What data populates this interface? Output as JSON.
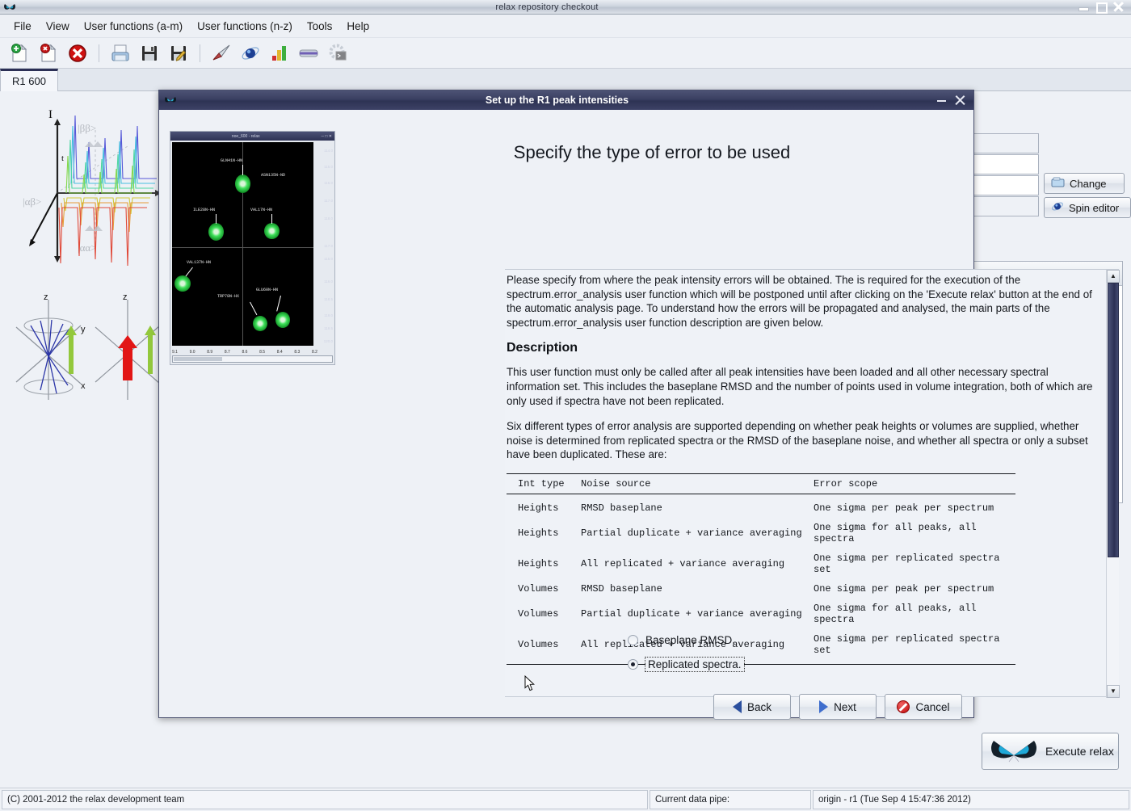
{
  "window": {
    "title": "relax repository checkout",
    "icon": "butterfly-icon",
    "minimize": "–",
    "maximize": "□",
    "close": "✕"
  },
  "menubar": {
    "items": [
      {
        "label": "File"
      },
      {
        "label": "View"
      },
      {
        "label": "User functions (a-m)"
      },
      {
        "label": "User functions (n-z)"
      },
      {
        "label": "Tools"
      },
      {
        "label": "Help"
      }
    ]
  },
  "toolbar": {
    "items": [
      {
        "name": "new-analysis-icon",
        "title": "New analysis"
      },
      {
        "name": "close-analysis-icon",
        "title": "Close analysis"
      },
      {
        "name": "close-all-analyses-icon",
        "title": "Close all analyses"
      },
      {
        "name": "open-state-icon",
        "title": "Open relax state"
      },
      {
        "name": "save-state-icon",
        "title": "Save state"
      },
      {
        "name": "save-state-as-icon",
        "title": "Save state as"
      },
      {
        "name": "run-script-icon",
        "title": "Run script"
      },
      {
        "name": "spin-viewer-icon",
        "title": "Spin viewer"
      },
      {
        "name": "results-viewer-icon",
        "title": "Results viewer"
      },
      {
        "name": "pipe-editor-icon",
        "title": "Data pipe editor"
      },
      {
        "name": "prompt-icon",
        "title": "relax prompt"
      }
    ]
  },
  "tabs": [
    {
      "label": "R1 600",
      "active": true
    }
  ],
  "right_panel": {
    "change_button": "Change",
    "spin_editor_button": "Spin editor"
  },
  "execute": {
    "label": "Execute relax",
    "icon": "butterfly-icon"
  },
  "statusbar": {
    "copyright": "(C) 2001-2012 the relax development team",
    "pipe_label": "Current data pipe:",
    "pipe_value": "origin - r1 (Tue Sep  4 15:47:36 2012)"
  },
  "dialog": {
    "title": "Set up the R1 peak intensities",
    "icon": "butterfly-icon",
    "minimize": "–",
    "close": "✕",
    "heading": "Specify the type of error to be used",
    "thumbnail": {
      "title": "noe_600 - relax",
      "peaks": [
        {
          "label": "GLN41N-HN"
        },
        {
          "label": "ASN135N-ND"
        },
        {
          "label": "ILE28N-HN"
        },
        {
          "label": "VAL17N-HN"
        },
        {
          "label": "VAL137N-HN"
        },
        {
          "label": "TRP78N-HX"
        },
        {
          "label": "GLU60N-HN"
        }
      ],
      "y_ticks": [
        "114.0",
        "115.0",
        "116.0",
        "117.0",
        "118.0",
        "117.0",
        "115.0",
        "116.0",
        "118.5",
        "119.0",
        "119.5",
        "120.0"
      ],
      "x_ticks": [
        "9.1",
        "9.0",
        "8.9",
        "8.7",
        "8.6",
        "8.5",
        "8.4",
        "8.3",
        "8.2"
      ]
    },
    "help": {
      "intro": "Please specify from where the peak intensity errors will be obtained.  The is required for the execution of the spectrum.error_analysis user function which will be postponed until after clicking on the 'Execute relax' button at the end of the automatic analysis page.  To understand how the errors will be propagated and analysed, the main parts of the spectrum.error_analysis user function description are given below.",
      "description_heading": "Description",
      "paragraph1": "This user function must only be called after all peak intensities have been loaded and all other necessary spectral information set.  This includes the baseplane RMSD and the number of points used in volume integration, both of which are only used if spectra have not been replicated.",
      "paragraph2": "Six different types of error analysis are supported depending on whether peak heights or volumes are supplied, whether noise is determined from replicated spectra or the RMSD of the baseplane noise, and whether all spectra or only a subset have been duplicated.  These are:",
      "table": {
        "headers": [
          "Int type",
          "Noise source",
          "Error scope"
        ],
        "rows": [
          [
            "Heights",
            "RMSD baseplane",
            "One sigma per peak per spectrum"
          ],
          [
            "Heights",
            "Partial duplicate + variance averaging",
            "One sigma for all peaks, all spectra"
          ],
          [
            "Heights",
            "All replicated + variance averaging",
            "One sigma per replicated spectra set"
          ],
          [
            "Volumes",
            "RMSD baseplane",
            "One sigma per peak per spectrum"
          ],
          [
            "Volumes",
            "Partial duplicate + variance averaging",
            "One sigma for all peaks, all spectra"
          ],
          [
            "Volumes",
            "All replicated + variance averaging",
            "One sigma per replicated spectra set"
          ]
        ]
      }
    },
    "options": [
      {
        "label": "Baseplane RMSD.",
        "selected": false,
        "focused": false
      },
      {
        "label": "Replicated spectra.",
        "selected": true,
        "focused": true
      }
    ],
    "buttons": {
      "back": "Back",
      "next": "Next",
      "cancel": "Cancel"
    }
  },
  "colors": {
    "dialog_title_bg": "#343a5e",
    "scrollbar_thumb": "#343a5e",
    "tab_accent": "#2b2f55",
    "page_bg": "#eef1f6",
    "peak_green": "#1fbf3f"
  }
}
